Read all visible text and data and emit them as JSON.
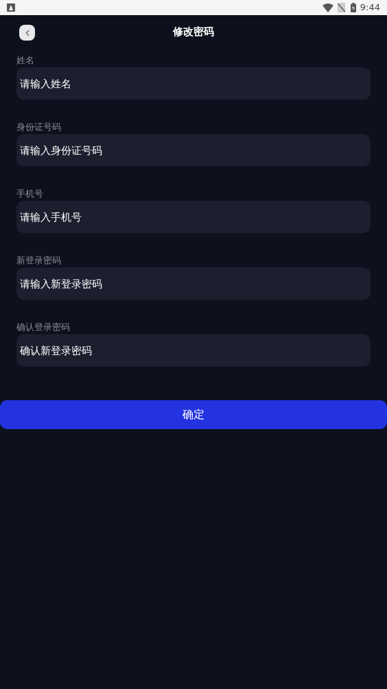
{
  "status_bar": {
    "time": "9:44"
  },
  "header": {
    "title": "修改密码"
  },
  "fields": [
    {
      "label": "姓名",
      "placeholder": "请输入姓名"
    },
    {
      "label": "身份证号码",
      "placeholder": "请输入身份证号码"
    },
    {
      "label": "手机号",
      "placeholder": "请输入手机号"
    },
    {
      "label": "新登录密码",
      "placeholder": "请输入新登录密码"
    },
    {
      "label": "确认登录密码",
      "placeholder": "确认新登录密码"
    }
  ],
  "submit_button": "确定"
}
